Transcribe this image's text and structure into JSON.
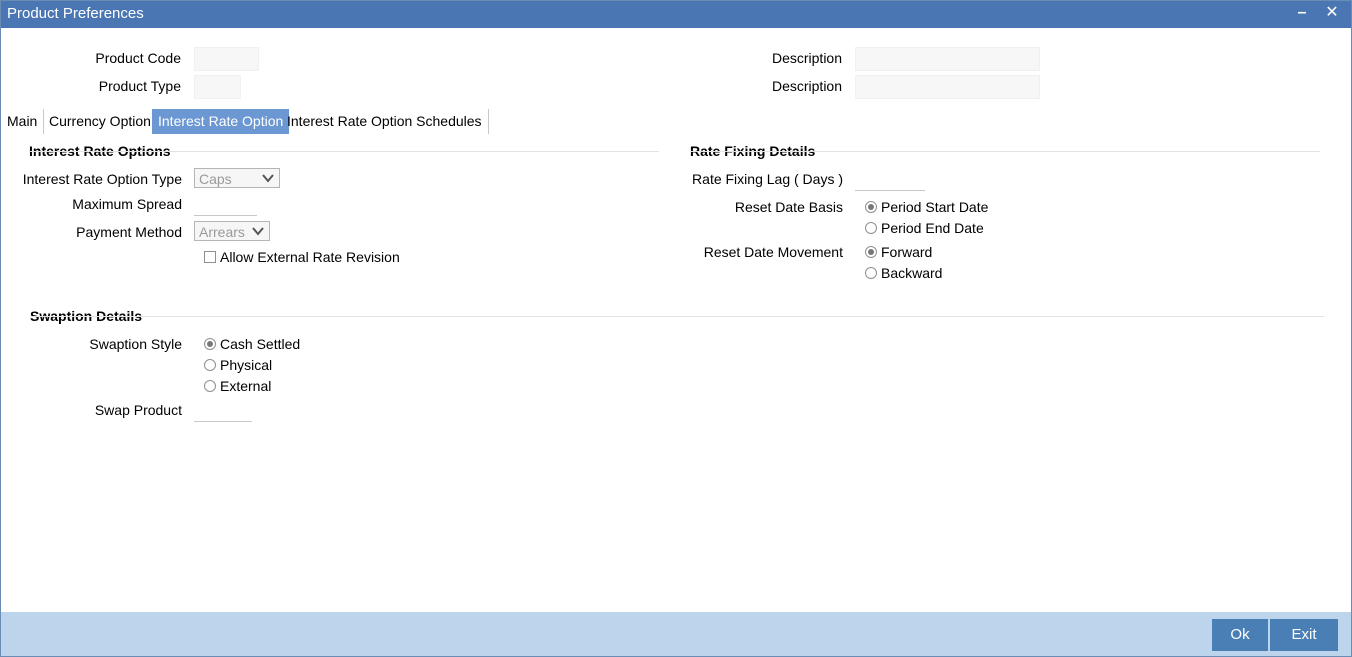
{
  "window": {
    "title": "Product Preferences"
  },
  "header": {
    "product_code_label": "Product Code",
    "product_type_label": "Product Type",
    "description_label_1": "Description",
    "description_label_2": "Description",
    "product_code_value": "",
    "product_type_value": "",
    "description_value_1": "",
    "description_value_2": ""
  },
  "tabs": [
    {
      "label": "Main",
      "active": false
    },
    {
      "label": "Currency Option",
      "active": false
    },
    {
      "label": "Interest Rate Option",
      "active": true
    },
    {
      "label": "Interest Rate Option Schedules",
      "active": false
    }
  ],
  "interest_rate_options": {
    "heading": "Interest Rate Options",
    "option_type_label": "Interest Rate Option Type",
    "option_type_value": "Caps",
    "max_spread_label": "Maximum Spread",
    "max_spread_value": "",
    "payment_method_label": "Payment Method",
    "payment_method_value": "Arrears",
    "allow_external_label": "Allow External Rate Revision",
    "allow_external_checked": false
  },
  "rate_fixing": {
    "heading": "Rate Fixing Details",
    "lag_label": "Rate Fixing Lag ( Days )",
    "lag_value": "",
    "reset_basis_label": "Reset Date Basis",
    "reset_basis_options": [
      "Period Start Date",
      "Period End Date"
    ],
    "reset_basis_selected": "Period Start Date",
    "reset_movement_label": "Reset Date Movement",
    "reset_movement_options": [
      "Forward",
      "Backward"
    ],
    "reset_movement_selected": "Forward"
  },
  "swaption": {
    "heading": "Swaption Details",
    "style_label": "Swaption Style",
    "style_options": [
      "Cash Settled",
      "Physical",
      "External"
    ],
    "style_selected": "Cash Settled",
    "swap_product_label": "Swap Product",
    "swap_product_value": ""
  },
  "footer": {
    "ok_label": "Ok",
    "exit_label": "Exit"
  }
}
